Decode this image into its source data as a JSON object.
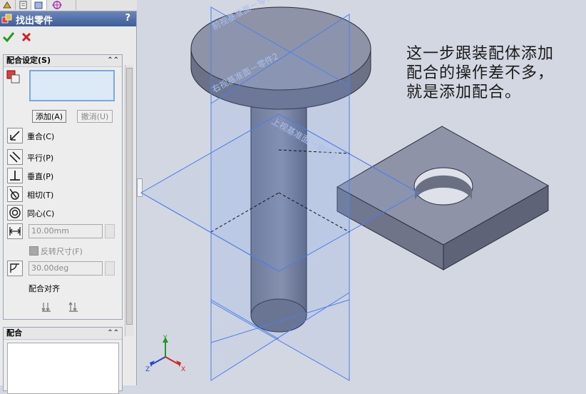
{
  "tabs": [
    {
      "icon": "feature-manager-icon"
    },
    {
      "icon": "property-manager-icon"
    },
    {
      "icon": "configuration-manager-icon"
    },
    {
      "icon": "dimxpert-icon"
    }
  ],
  "header": {
    "title": "找出零件",
    "help": "?",
    "icon": "mate-icon"
  },
  "actions": {
    "ok_icon": "check-icon",
    "cancel_icon": "close-icon"
  },
  "mate_settings": {
    "title": "配合设定(S)",
    "add_label": "添加(A)",
    "undo_label": "撤消(U)",
    "mates": [
      {
        "label": "重合(C)",
        "icon": "coincident-icon"
      },
      {
        "label": "平行(P)",
        "icon": "parallel-icon"
      },
      {
        "label": "垂直(P)",
        "icon": "perpendicular-icon"
      },
      {
        "label": "相切(T)",
        "icon": "tangent-icon"
      },
      {
        "label": "同心(C)",
        "icon": "concentric-icon"
      }
    ],
    "distance_value": "10.00mm",
    "flip_label": "反转尺寸(F)",
    "angle_value": "30.00deg",
    "align_label": "配合对齐"
  },
  "mates_section": {
    "title": "配合"
  },
  "viewport": {
    "plane_labels": [
      "前视基准面－零件1",
      "右视基准面－零件2",
      "上视基准面－零件2"
    ],
    "note": "这一步跟装配体添加配合的操作差不多，就是添加配合。",
    "triad": {
      "x": "X",
      "y": "Y",
      "z": "Z"
    }
  },
  "colors": {
    "title_bar": "#4a6aa4",
    "plane": "#4d7ee8",
    "part": "#7a7e94"
  }
}
